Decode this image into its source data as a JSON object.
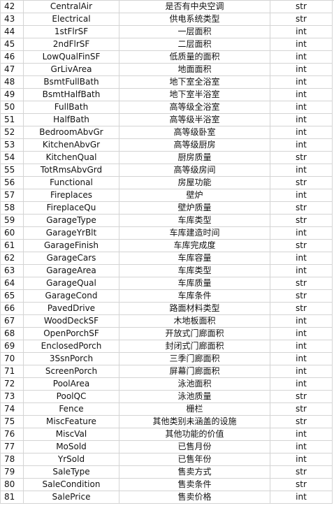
{
  "spreadsheet": {
    "rows": [
      {
        "num": "42",
        "name": "CentralAir",
        "desc": "是否有中央空调",
        "type": "str"
      },
      {
        "num": "43",
        "name": "Electrical",
        "desc": "供电系统类型",
        "type": "str"
      },
      {
        "num": "44",
        "name": "1stFlrSF",
        "desc": "一层面积",
        "type": "int"
      },
      {
        "num": "45",
        "name": "2ndFlrSF",
        "desc": "二层面积",
        "type": "int"
      },
      {
        "num": "46",
        "name": "LowQualFinSF",
        "desc": "低质量的面积",
        "type": "int"
      },
      {
        "num": "47",
        "name": "GrLivArea",
        "desc": "地面面积",
        "type": "int"
      },
      {
        "num": "48",
        "name": "BsmtFullBath",
        "desc": "地下室全浴室",
        "type": "int"
      },
      {
        "num": "49",
        "name": "BsmtHalfBath",
        "desc": "地下室半浴室",
        "type": "int"
      },
      {
        "num": "50",
        "name": "FullBath",
        "desc": "高等级全浴室",
        "type": "int"
      },
      {
        "num": "51",
        "name": "HalfBath",
        "desc": "高等级半浴室",
        "type": "int"
      },
      {
        "num": "52",
        "name": "BedroomAbvGr",
        "desc": "高等级卧室",
        "type": "int"
      },
      {
        "num": "53",
        "name": "KitchenAbvGr",
        "desc": "高等级厨房",
        "type": "int"
      },
      {
        "num": "54",
        "name": "KitchenQual",
        "desc": "厨房质量",
        "type": "str"
      },
      {
        "num": "55",
        "name": "TotRmsAbvGrd",
        "desc": "高等级房间",
        "type": "int"
      },
      {
        "num": "56",
        "name": "Functional",
        "desc": "房屋功能",
        "type": "str"
      },
      {
        "num": "57",
        "name": "Fireplaces",
        "desc": "壁炉",
        "type": "int"
      },
      {
        "num": "58",
        "name": "FireplaceQu",
        "desc": "壁炉质量",
        "type": "str"
      },
      {
        "num": "59",
        "name": "GarageType",
        "desc": "车库类型",
        "type": "str"
      },
      {
        "num": "60",
        "name": "GarageYrBlt",
        "desc": "车库建造时间",
        "type": "int"
      },
      {
        "num": "61",
        "name": "GarageFinish",
        "desc": "车库完成度",
        "type": "str"
      },
      {
        "num": "62",
        "name": "GarageCars",
        "desc": "车库容量",
        "type": "int"
      },
      {
        "num": "63",
        "name": "GarageArea",
        "desc": "车库类型",
        "type": "int"
      },
      {
        "num": "64",
        "name": "GarageQual",
        "desc": "车库质量",
        "type": "str"
      },
      {
        "num": "65",
        "name": "GarageCond",
        "desc": "车库条件",
        "type": "str"
      },
      {
        "num": "66",
        "name": "PavedDrive",
        "desc": "路面材料类型",
        "type": "str"
      },
      {
        "num": "67",
        "name": "WoodDeckSF",
        "desc": "木地板面积",
        "type": "int"
      },
      {
        "num": "68",
        "name": "OpenPorchSF",
        "desc": "开放式门廊面积",
        "type": "int"
      },
      {
        "num": "69",
        "name": "EnclosedPorch",
        "desc": "封闭式门廊面积",
        "type": "int"
      },
      {
        "num": "70",
        "name": "3SsnPorch",
        "desc": "三季门廊面积",
        "type": "int"
      },
      {
        "num": "71",
        "name": "ScreenPorch",
        "desc": "屏幕门廊面积",
        "type": "int"
      },
      {
        "num": "72",
        "name": "PoolArea",
        "desc": "泳池面积",
        "type": "int"
      },
      {
        "num": "73",
        "name": "PoolQC",
        "desc": "泳池质量",
        "type": "str"
      },
      {
        "num": "74",
        "name": "Fence",
        "desc": "栅栏",
        "type": "str"
      },
      {
        "num": "75",
        "name": "MiscFeature",
        "desc": "其他类别未涵盖的设施",
        "type": "str"
      },
      {
        "num": "76",
        "name": "MiscVal",
        "desc": "其他功能的价值",
        "type": "int"
      },
      {
        "num": "77",
        "name": "MoSold",
        "desc": "已售月份",
        "type": "int"
      },
      {
        "num": "78",
        "name": "YrSold",
        "desc": "已售年份",
        "type": "int"
      },
      {
        "num": "79",
        "name": "SaleType",
        "desc": "售卖方式",
        "type": "str"
      },
      {
        "num": "80",
        "name": "SaleCondition",
        "desc": "售卖条件",
        "type": "str"
      },
      {
        "num": "81",
        "name": "SalePrice",
        "desc": "售卖价格",
        "type": "int"
      }
    ]
  }
}
